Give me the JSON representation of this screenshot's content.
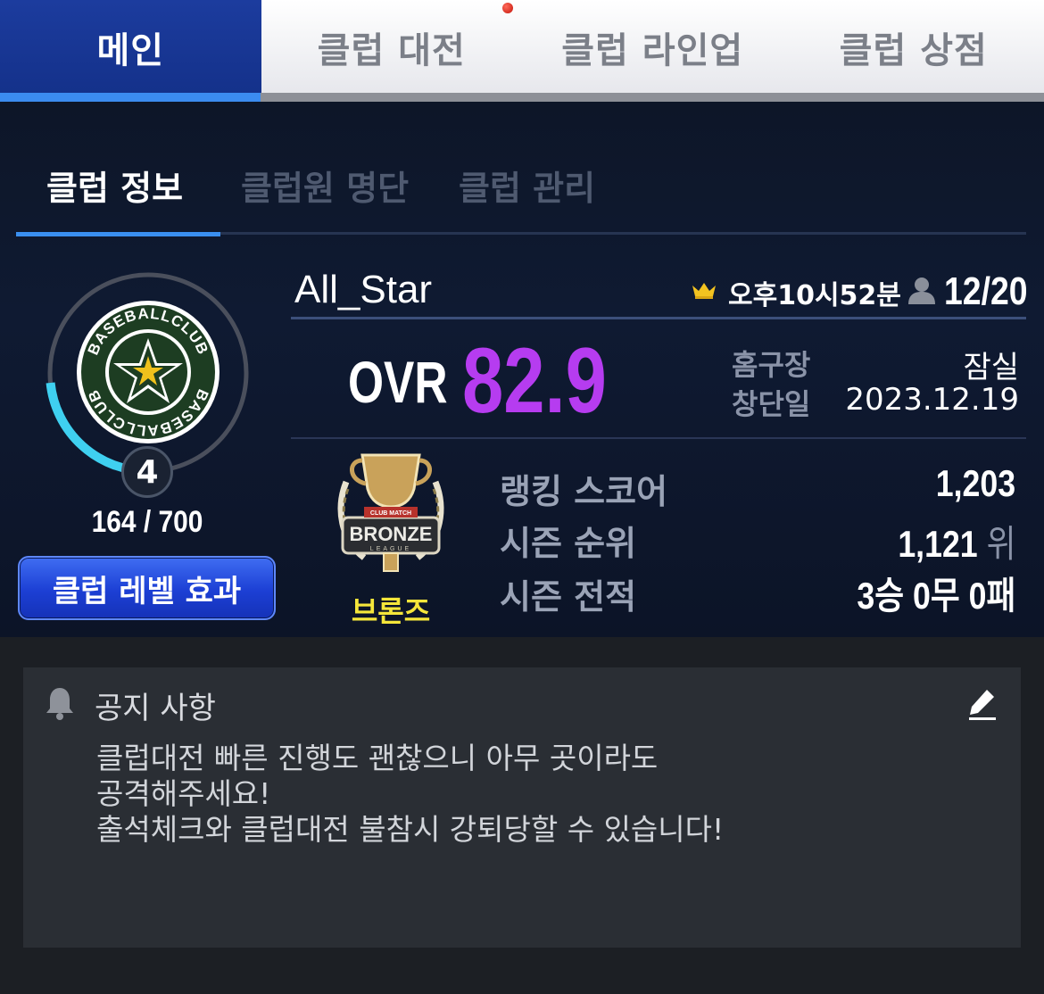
{
  "top_nav": {
    "tabs": [
      {
        "label": "메인",
        "active": true
      },
      {
        "label": "클럽 대전",
        "active": false
      },
      {
        "label": "클럽 라인업",
        "active": false
      },
      {
        "label": "클럽 상점",
        "active": false
      }
    ]
  },
  "sub_tabs": [
    {
      "label": "클럽 정보",
      "active": true
    },
    {
      "label": "클럽원 명단",
      "active": false
    },
    {
      "label": "클럽 관리",
      "active": false
    }
  ],
  "club": {
    "name": "All_Star",
    "time": "오후10시52분",
    "members": "12/20",
    "level": "4",
    "exp": "164 / 700",
    "exp_fraction": 0.234,
    "level_button": "클럽 레벨 효과",
    "ovr_label": "OVR",
    "ovr_value": "82.9",
    "home_label": "홈구장",
    "home_value": "잠실",
    "founded_label": "창단일",
    "founded_value": "2023.12.19",
    "tier_name": "브론즈",
    "ranking_label": "랭킹 스코어",
    "ranking_value": "1,203",
    "season_rank_label": "시즌 순위",
    "season_rank_value": "1,121",
    "season_rank_unit": "위",
    "season_record_label": "시즌 전적",
    "season_record_value": "3승 0무 0패"
  },
  "logo": {
    "text_top": "BASEBALLCLUB",
    "text_bottom": "BASEBALLCLUB"
  },
  "trophy": {
    "ribbon": "CLUB MATCH",
    "label": "BRONZE",
    "sub": "LEAGUE"
  },
  "notice": {
    "title": "공지 사항",
    "lines": [
      "클럽대전 빠른 진행도 괜찮으니 아무 곳이라도",
      "공격해주세요!",
      "출석체크와 클럽대전 불참시 강퇴당할 수 있습니다!"
    ]
  },
  "colors": {
    "active_tab": "#1c3c9e",
    "ovr": "#b63cf0",
    "tier": "#f5e63a",
    "exp_ring": "#3fd0f0"
  }
}
